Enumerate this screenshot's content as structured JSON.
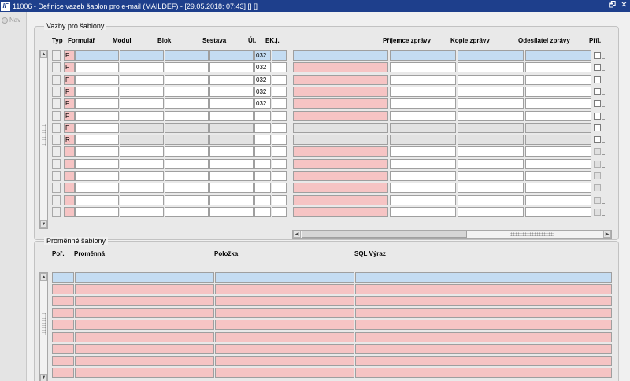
{
  "window": {
    "title": "11006 - Definice vazeb šablon pro e-mail (MAILDEF) - [29.05.2018; 07:43]  [] []",
    "app_icon": "IF",
    "restore_glyph": "🗗",
    "close_glyph": "✕"
  },
  "nav": {
    "label": "Nav"
  },
  "vazby": {
    "title": "Vazby pro šablony",
    "headers": {
      "typ": "Typ",
      "formular": "Formulář",
      "modul": "Modul",
      "blok": "Blok",
      "sestava": "Sestava",
      "ul": "Úl.",
      "ekj": "EK.j.",
      "prijemce": "Příjemce zprávy",
      "kopie": "Kopie zprávy",
      "odesilatel": "Odesílatel zprávy",
      "pril": "Příl."
    },
    "rows": [
      {
        "typ": "F",
        "formular": "...",
        "ul": "032"
      },
      {
        "typ": "F",
        "formular": "",
        "ul": "032"
      },
      {
        "typ": "F",
        "formular": "",
        "ul": "032"
      },
      {
        "typ": "F",
        "formular": "",
        "ul": "032"
      },
      {
        "typ": "F",
        "formular": "",
        "ul": "032"
      },
      {
        "typ": "F",
        "formular": "",
        "ul": ""
      },
      {
        "typ": "F",
        "formular": "",
        "ul": ""
      },
      {
        "typ": "R",
        "formular": "",
        "ul": ""
      },
      {
        "typ": "",
        "formular": "",
        "ul": ""
      },
      {
        "typ": "",
        "formular": "",
        "ul": ""
      },
      {
        "typ": "",
        "formular": "",
        "ul": ""
      },
      {
        "typ": "",
        "formular": "",
        "ul": ""
      },
      {
        "typ": "",
        "formular": "",
        "ul": ""
      },
      {
        "typ": "",
        "formular": "",
        "ul": ""
      }
    ],
    "scroll_up": "▲",
    "scroll_down": "▼",
    "scroll_left": "◀",
    "scroll_right": "▶"
  },
  "promenne": {
    "title": "Proměnné šablony",
    "headers": {
      "por": "Poř.",
      "promenna": "Proměnná",
      "polozka": "Položka",
      "sql": "SQL Výraz"
    },
    "row_count": 9,
    "scroll_up": "▲",
    "scroll_down": "▼"
  },
  "colors": {
    "title_bar": "#1e3f8c",
    "current_row": "#c4dcf2",
    "required": "#f6c4c4",
    "disabled": "#e2e2e2"
  }
}
